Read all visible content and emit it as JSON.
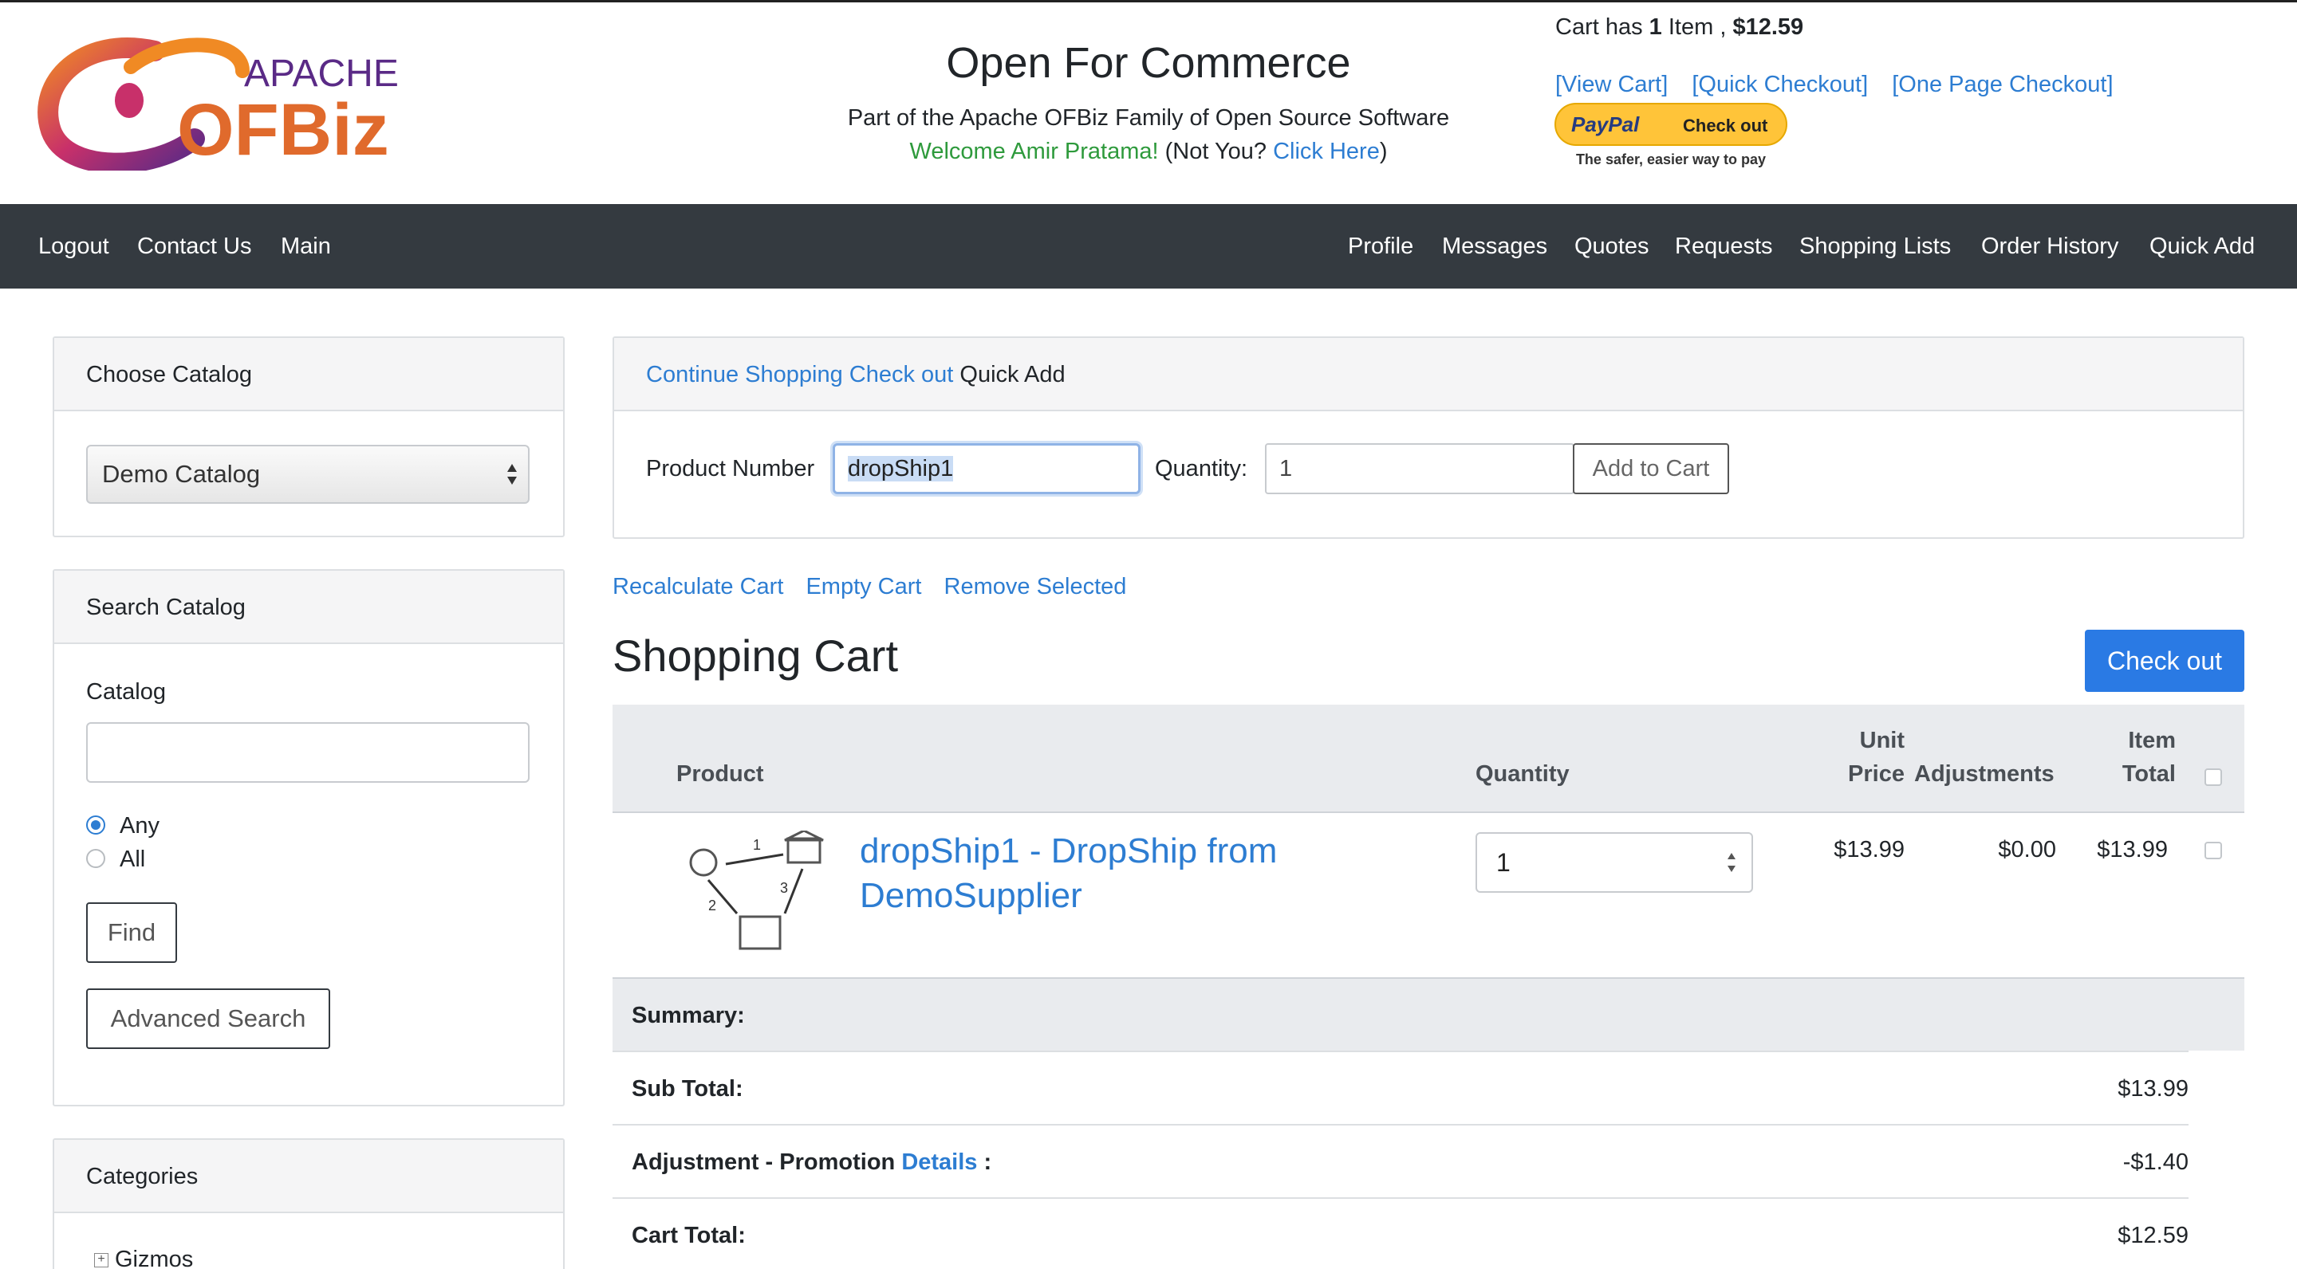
{
  "header": {
    "site_title": "Open For Commerce",
    "site_subtitle": "Part of the Apache OFBiz Family of Open Source Software",
    "welcome_text": "Welcome Amir Pratama!",
    "not_you_text": "(Not You?",
    "click_here": "Click Here",
    "close_paren": ")",
    "logo_text_top": "APACHE",
    "logo_text_main": "OFBiz",
    "cart_summary": {
      "prefix": "Cart has",
      "count": "1",
      "item_word": "Item ,",
      "total": "$12.59"
    },
    "cart_links": [
      "[View Cart]",
      "[Quick Checkout]",
      "[One Page Checkout]"
    ],
    "paypal": {
      "brand": "PayPal",
      "label": "Check out",
      "tagline": "The safer, easier way to pay"
    }
  },
  "navbar": {
    "left": [
      "Logout",
      "Contact Us",
      "Main"
    ],
    "right": [
      "Profile",
      "Messages",
      "Quotes",
      "Requests",
      "Shopping Lists",
      "Order History",
      "Quick Add"
    ]
  },
  "sidebar": {
    "choose_catalog": {
      "title": "Choose Catalog",
      "selected": "Demo Catalog"
    },
    "search_catalog": {
      "title": "Search Catalog",
      "catalog_label": "Catalog",
      "catalog_value": "",
      "radio_any": "Any",
      "radio_all": "All",
      "selected_radio": "Any",
      "find_label": "Find",
      "advanced_label": "Advanced Search"
    },
    "categories": {
      "title": "Categories",
      "items": [
        "Gizmos"
      ]
    }
  },
  "quick_add": {
    "continue_shopping": "Continue Shopping",
    "check_out": "Check out",
    "title": "Quick Add",
    "product_number_label": "Product Number",
    "product_number_value": "dropShip1",
    "quantity_label": "Quantity:",
    "quantity_value": "1",
    "add_to_cart": "Add to Cart"
  },
  "cart_actions": [
    "Recalculate Cart",
    "Empty Cart",
    "Remove Selected"
  ],
  "cart": {
    "title": "Shopping Cart",
    "checkout_button": "Check out",
    "headers": {
      "product": "Product",
      "quantity": "Quantity",
      "unit_price_1": "Unit",
      "unit_price_2": "Price",
      "adjustments": "Adjustments",
      "item_total_1": "Item",
      "item_total_2": "Total"
    },
    "items": [
      {
        "name": "dropShip1 - DropShip from DemoSupplier",
        "quantity": "1",
        "unit_price": "$13.99",
        "adjustments": "$0.00",
        "item_total": "$13.99"
      }
    ],
    "summary": {
      "label": "Summary:",
      "sub_total_label": "Sub Total:",
      "sub_total": "$13.99",
      "adjustment_label": "Adjustment - Promotion",
      "details_link": "Details",
      "adjustment_colon": ":",
      "adjustment_value": "-$1.40",
      "cart_total_label": "Cart Total:",
      "cart_total": "$12.59"
    }
  },
  "colors": {
    "link": "#2d7dd2",
    "navbar": "#343a40",
    "primary_button": "#2a7ae4",
    "welcome_green": "#2e9a3c"
  }
}
